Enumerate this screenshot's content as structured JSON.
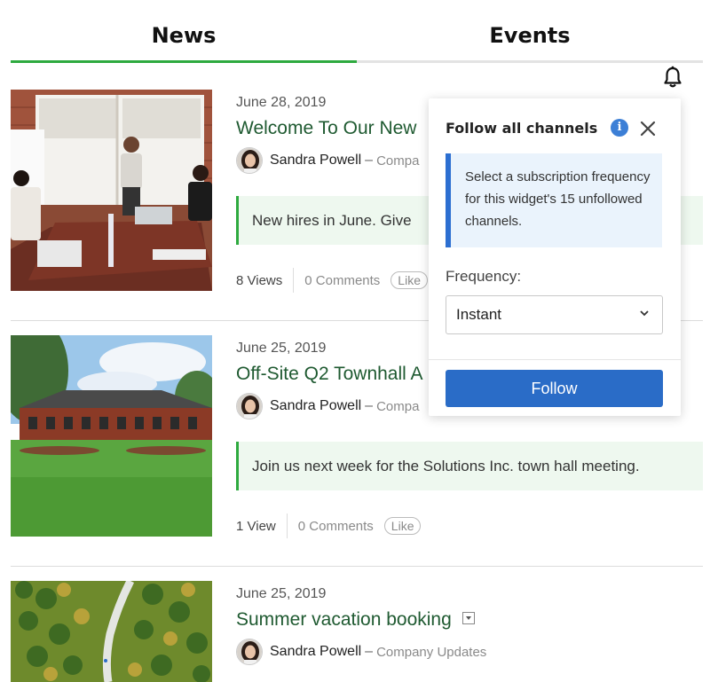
{
  "tabs": {
    "news": "News",
    "events": "Events",
    "active": "News",
    "active_color": "#2eaa3f"
  },
  "notification_icon": "bell-icon",
  "posts": [
    {
      "date": "June 28, 2019",
      "title": "Welcome To Our New",
      "author": "Sandra Powell",
      "channel": "Compa",
      "excerpt": "New hires in June. Give",
      "views": "8 Views",
      "comments": "0 Comments",
      "like": "Like"
    },
    {
      "date": "June 25, 2019",
      "title": "Off-Site Q2 Townhall A",
      "author": "Sandra Powell",
      "channel": "Compa",
      "excerpt": "Join us next week for the Solutions Inc. town hall meeting.",
      "views": "1 View",
      "comments": "0 Comments",
      "like": "Like"
    },
    {
      "date": "June 25, 2019",
      "title": "Summer vacation booking",
      "author": "Sandra Powell",
      "channel": "Company Updates"
    }
  ],
  "dash": "–",
  "popover": {
    "title": "Follow all channels",
    "info_glyph": "i",
    "note": "Select a subscription frequency for this widget's 15 unfollowed channels.",
    "frequency_label": "Frequency:",
    "frequency_value": "Instant",
    "button": "Follow",
    "button_color": "#2a6cc7",
    "note_accent": "#2c6fd1"
  }
}
